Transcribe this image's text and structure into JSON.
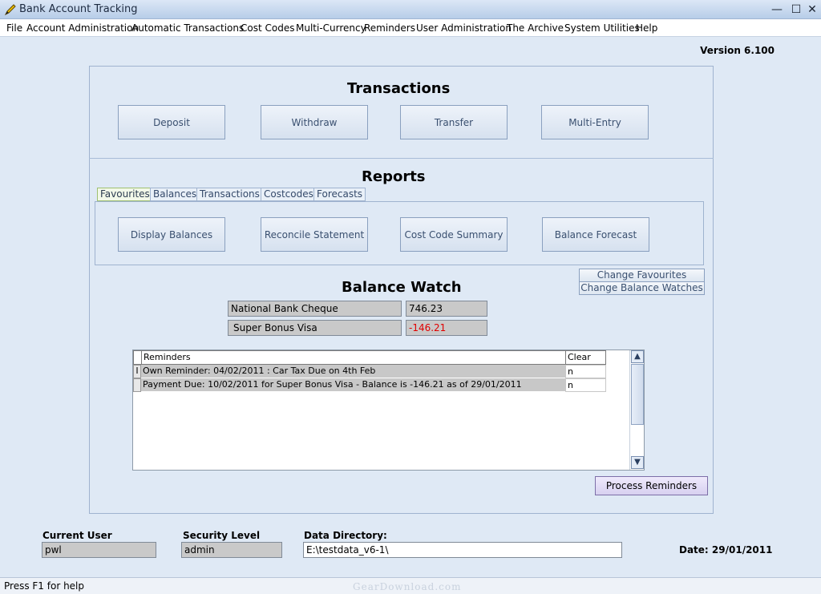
{
  "window": {
    "title": "Bank Account Tracking",
    "minimize": "—",
    "maximize": "☐",
    "close": "✕"
  },
  "menu": [
    "File",
    "Account Administration",
    "Automatic Transactions",
    "Cost Codes",
    "Multi-Currency",
    "Reminders",
    "User Administration",
    "The Archive",
    "System Utilities",
    "Help"
  ],
  "version": "Version 6.100",
  "transactions": {
    "heading": "Transactions",
    "buttons": [
      "Deposit",
      "Withdraw",
      "Transfer",
      "Multi-Entry"
    ]
  },
  "reports": {
    "heading": "Reports",
    "tabs": [
      "Favourites",
      "Balances",
      "Transactions",
      "Costcodes",
      "Forecasts"
    ],
    "active_tab": "Favourites",
    "buttons": [
      "Display Balances",
      "Reconcile Statement",
      "Cost Code Summary",
      "Balance Forecast"
    ]
  },
  "favourites": {
    "change_favourites": "Change Favourites",
    "change_balance_watches": "Change Balance Watches"
  },
  "balance_watch": {
    "heading": "Balance Watch",
    "rows": [
      {
        "account": "National Bank Cheque",
        "balance": "746.23",
        "color": "#000000"
      },
      {
        "account": "Super Bonus Visa",
        "balance": "-146.21",
        "color": "#e00000"
      }
    ]
  },
  "reminders": {
    "columns": [
      "Reminders",
      "Clear"
    ],
    "rows": [
      {
        "marker": "I",
        "text": "Own Reminder: 04/02/2011 : Car Tax Due on 4th Feb",
        "clear": "n"
      },
      {
        "marker": "",
        "text": "Payment Due: 10/02/2011 for  Super Bonus Visa - Balance is -146.21 as of 29/01/2011",
        "clear": "n"
      }
    ],
    "process_button": "Process Reminders"
  },
  "footer": {
    "current_user_label": "Current User",
    "current_user": "pwl",
    "security_level_label": "Security Level",
    "security_level": "admin",
    "data_directory_label": "Data Directory:",
    "data_directory": "E:\\testdata_v6-1\\",
    "date": "Date: 29/01/2011"
  },
  "status": "Press F1 for help",
  "watermark": "GearDownload.com"
}
